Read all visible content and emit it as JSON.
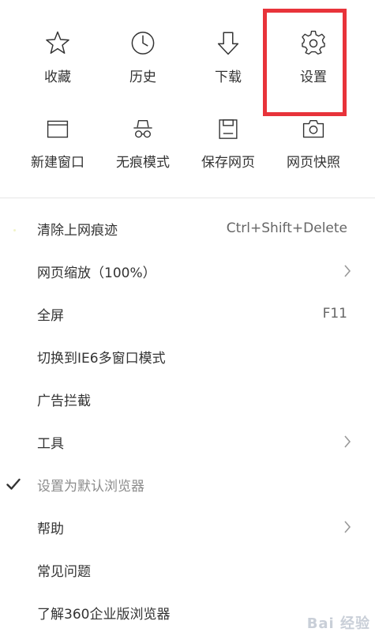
{
  "quick_actions": [
    {
      "label": "收藏",
      "icon": "star-icon"
    },
    {
      "label": "历史",
      "icon": "clock-icon"
    },
    {
      "label": "下载",
      "icon": "download-arrow-icon"
    },
    {
      "label": "设置",
      "icon": "gear-icon"
    },
    {
      "label": "新建窗口",
      "icon": "window-icon"
    },
    {
      "label": "无痕模式",
      "icon": "incognito-icon"
    },
    {
      "label": "保存网页",
      "icon": "save-icon"
    },
    {
      "label": "网页快照",
      "icon": "camera-icon"
    }
  ],
  "menu": {
    "items": [
      {
        "label": "清除上网痕迹",
        "shortcut": "Ctrl+Shift+Delete"
      },
      {
        "label": "网页缩放（100%）"
      },
      {
        "label": "全屏",
        "shortcut": "F11"
      },
      {
        "label": "切换到IE6多窗口模式"
      },
      {
        "label": "广告拦截"
      },
      {
        "label": "工具"
      },
      {
        "label": "设置为默认浏览器"
      },
      {
        "label": "帮助"
      },
      {
        "label": "常见问题"
      },
      {
        "label": "了解360企业版浏览器"
      }
    ]
  },
  "watermark": "Bai 经验",
  "colors": {
    "highlight": "#e8333a",
    "text": "#333333",
    "disabled_text": "#8c8c8c"
  }
}
